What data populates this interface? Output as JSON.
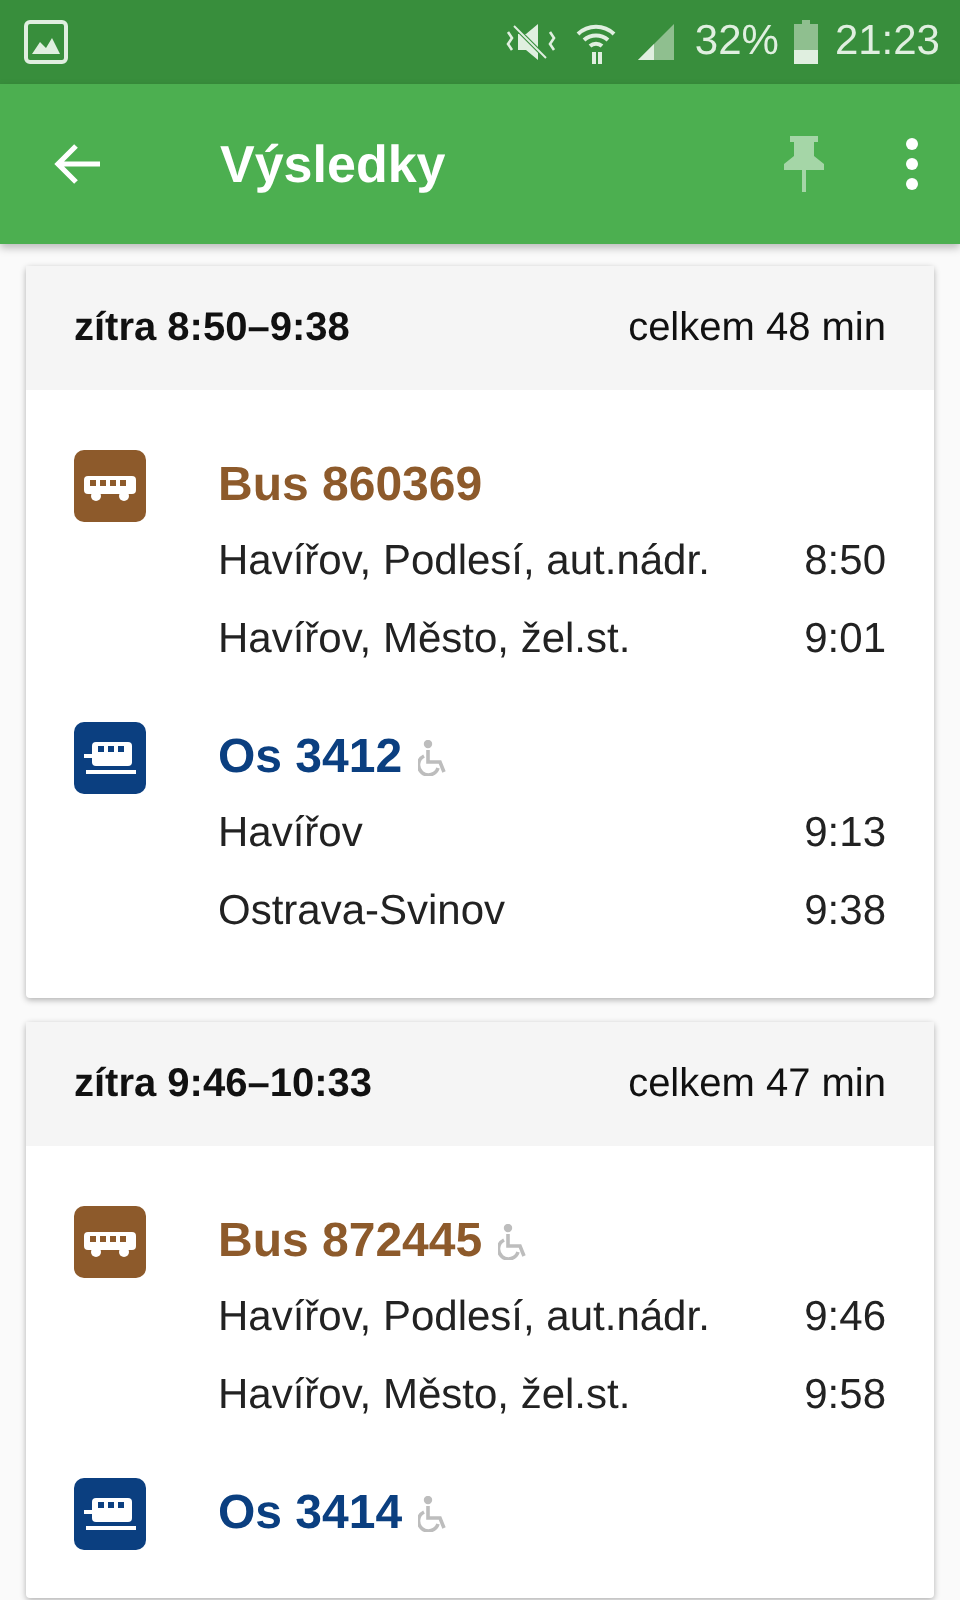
{
  "status_bar": {
    "battery": "32%",
    "time": "21:23"
  },
  "app_bar": {
    "title": "Výsledky"
  },
  "connections": [
    {
      "time_range": "zítra 8:50–9:38",
      "total": "celkem 48 min",
      "legs": [
        {
          "kind": "bus",
          "name": "Bus 860369",
          "wheelchair": false,
          "stops": [
            {
              "name": "Havířov, Podlesí, aut.nádr.",
              "time": "8:50"
            },
            {
              "name": "Havířov, Město, žel.st.",
              "time": "9:01"
            }
          ]
        },
        {
          "kind": "train",
          "name": "Os 3412",
          "wheelchair": true,
          "stops": [
            {
              "name": "Havířov",
              "time": "9:13"
            },
            {
              "name": "Ostrava-Svinov",
              "time": "9:38"
            }
          ]
        }
      ]
    },
    {
      "time_range": "zítra 9:46–10:33",
      "total": "celkem 47 min",
      "legs": [
        {
          "kind": "bus",
          "name": "Bus 872445",
          "wheelchair": true,
          "stops": [
            {
              "name": "Havířov, Podlesí, aut.nádr.",
              "time": "9:46"
            },
            {
              "name": "Havířov, Město, žel.st.",
              "time": "9:58"
            }
          ]
        },
        {
          "kind": "train",
          "name": "Os 3414",
          "wheelchair": true
        }
      ]
    }
  ]
}
